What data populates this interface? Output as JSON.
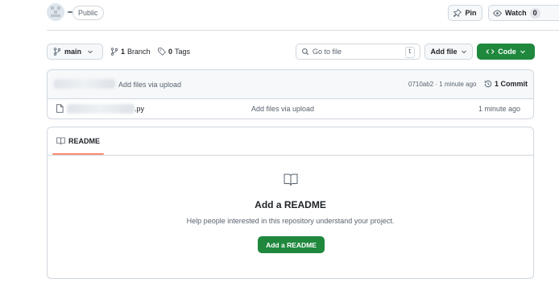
{
  "header": {
    "visibility_badge": "Public",
    "pin_label": "Pin",
    "watch_label": "Watch",
    "watch_count": "0"
  },
  "toolbar": {
    "branch_label": "main",
    "branches_count": "1",
    "branches_label": "Branch",
    "tags_count": "0",
    "tags_label": "Tags",
    "goto_placeholder": "Go to file",
    "goto_shortcut": "t",
    "add_file_label": "Add file",
    "code_label": "Code"
  },
  "latest_commit": {
    "message": "Add files via upload",
    "hash_time": "0710ab2 · 1 minute ago",
    "commit_count_label": "1 Commit"
  },
  "files": [
    {
      "name_suffix": ".py",
      "commit_message": "Add files via upload",
      "time": "1 minute ago"
    }
  ],
  "readme": {
    "tab_label": "README",
    "title": "Add a README",
    "description": "Help people interested in this repository understand your project.",
    "button_label": "Add a README"
  },
  "colors": {
    "primary_button": "#1f883d",
    "tab_underline": "#fd8c73",
    "border": "#d0d7de"
  },
  "icons": [
    "pin-icon",
    "eye-icon",
    "git-branch-icon",
    "tag-icon",
    "search-icon",
    "chevron-down-icon",
    "code-icon",
    "history-icon",
    "file-icon",
    "book-icon"
  ]
}
